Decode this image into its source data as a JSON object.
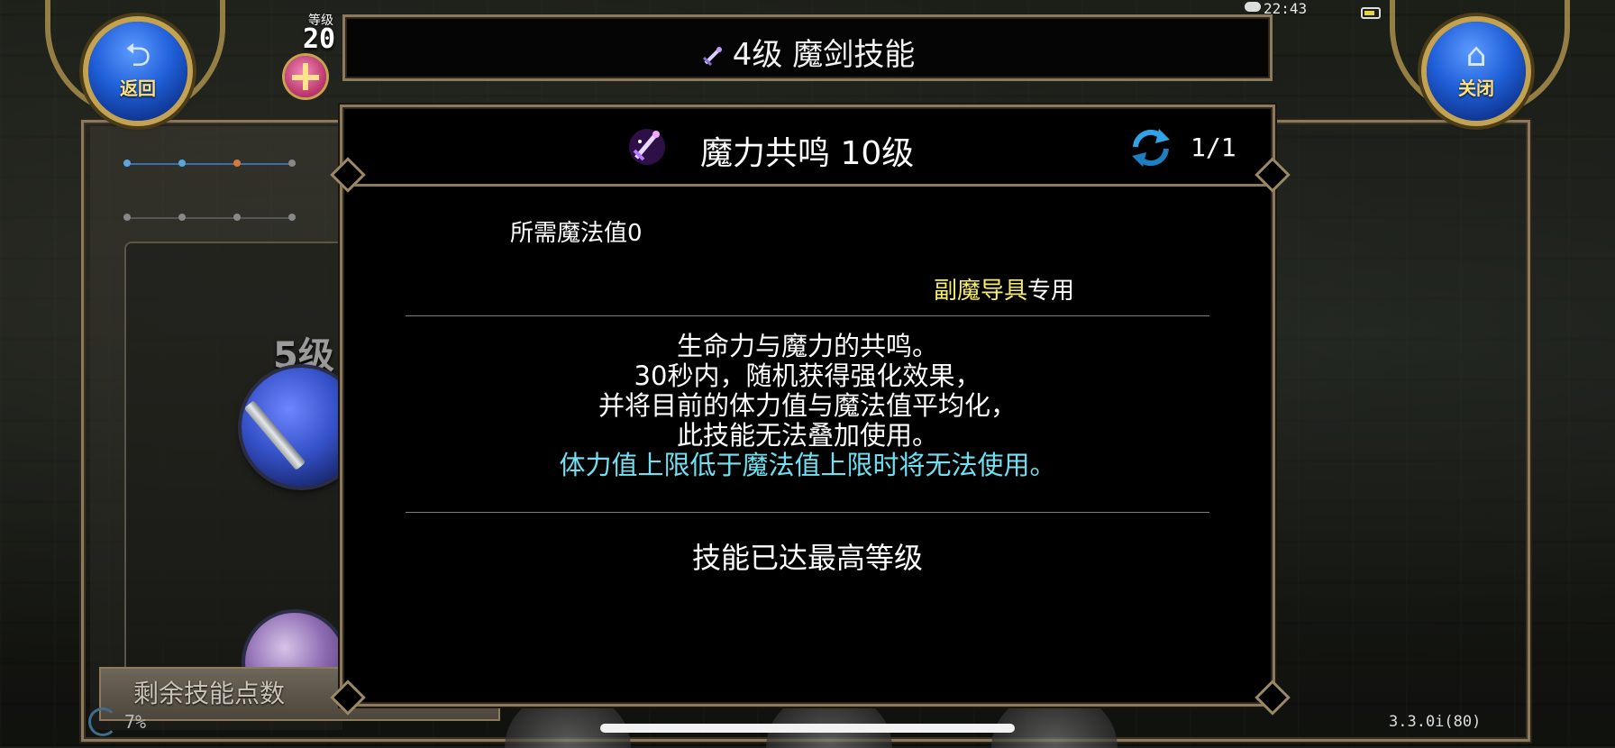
{
  "status_bar": {
    "time": "22:43"
  },
  "top_left": {
    "back_button_label": "返回",
    "player_level_label": "等级",
    "player_level_value": "20"
  },
  "top_right": {
    "close_button_label": "关闭"
  },
  "header": {
    "title": "4级 魔剑技能"
  },
  "dialog": {
    "skill_name": "魔力共鸣 10级",
    "page_counter": "1/1",
    "mp_cost": "所需魔法值0",
    "weapon_requirement_name": "副魔导具",
    "weapon_requirement_suffix": "专用",
    "description_lines": [
      "生命力与魔力的共鸣。",
      "30秒内，随机获得强化效果，",
      "并将目前的体力值与魔法值平均化，",
      "此技能无法叠加使用。"
    ],
    "warning_line": "体力值上限低于魔法值上限时将无法使用。",
    "max_level_text": "技能已达最高等级"
  },
  "background": {
    "skill_level_text": "5级",
    "remaining_points_label": "剩余技能点数",
    "percent_text": "7%",
    "version_text": "3.3.0i(80)"
  },
  "colors": {
    "frame_bronze": "#8d7a5c",
    "weapon_name": "#f7ef6a",
    "warning_text": "#6fe1f2",
    "button_blue": "#1f5fd8",
    "button_label": "#ffe27a"
  },
  "icons": {
    "back": "back-arrow-icon",
    "close": "home-icon",
    "header": "magic-sword-icon",
    "skill": "magic-sword-skill-icon",
    "refresh": "refresh-icon",
    "gift": "gift-icon"
  }
}
